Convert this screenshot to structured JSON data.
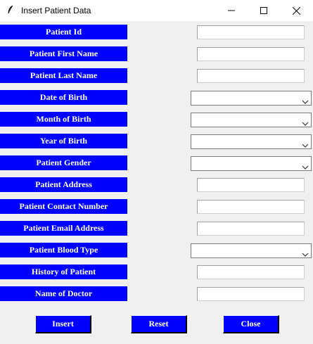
{
  "window": {
    "title": "Insert Patient Data",
    "icon": "feather-icon"
  },
  "form": {
    "fields": [
      {
        "label": "Patient Id",
        "type": "entry",
        "value": ""
      },
      {
        "label": "Patient First Name",
        "type": "entry",
        "value": ""
      },
      {
        "label": "Patient Last Name",
        "type": "entry",
        "value": ""
      },
      {
        "label": "Date of Birth",
        "type": "combobox",
        "value": ""
      },
      {
        "label": "Month of Birth",
        "type": "combobox",
        "value": ""
      },
      {
        "label": "Year of Birth",
        "type": "combobox",
        "value": ""
      },
      {
        "label": "Patient Gender",
        "type": "combobox",
        "value": ""
      },
      {
        "label": "Patient Address",
        "type": "entry",
        "value": ""
      },
      {
        "label": "Patient Contact Number",
        "type": "entry",
        "value": ""
      },
      {
        "label": "Patient Email Address",
        "type": "entry",
        "value": ""
      },
      {
        "label": "Patient Blood Type",
        "type": "combobox",
        "value": ""
      },
      {
        "label": "History of Patient",
        "type": "entry",
        "value": ""
      },
      {
        "label": "Name of Doctor",
        "type": "entry",
        "value": ""
      }
    ]
  },
  "buttons": {
    "insert": "Insert",
    "reset": "Reset",
    "close": "Close"
  },
  "colors": {
    "label_bg": "#0000ff",
    "label_fg": "#ffffff",
    "window_bg": "#f0f0f0"
  }
}
